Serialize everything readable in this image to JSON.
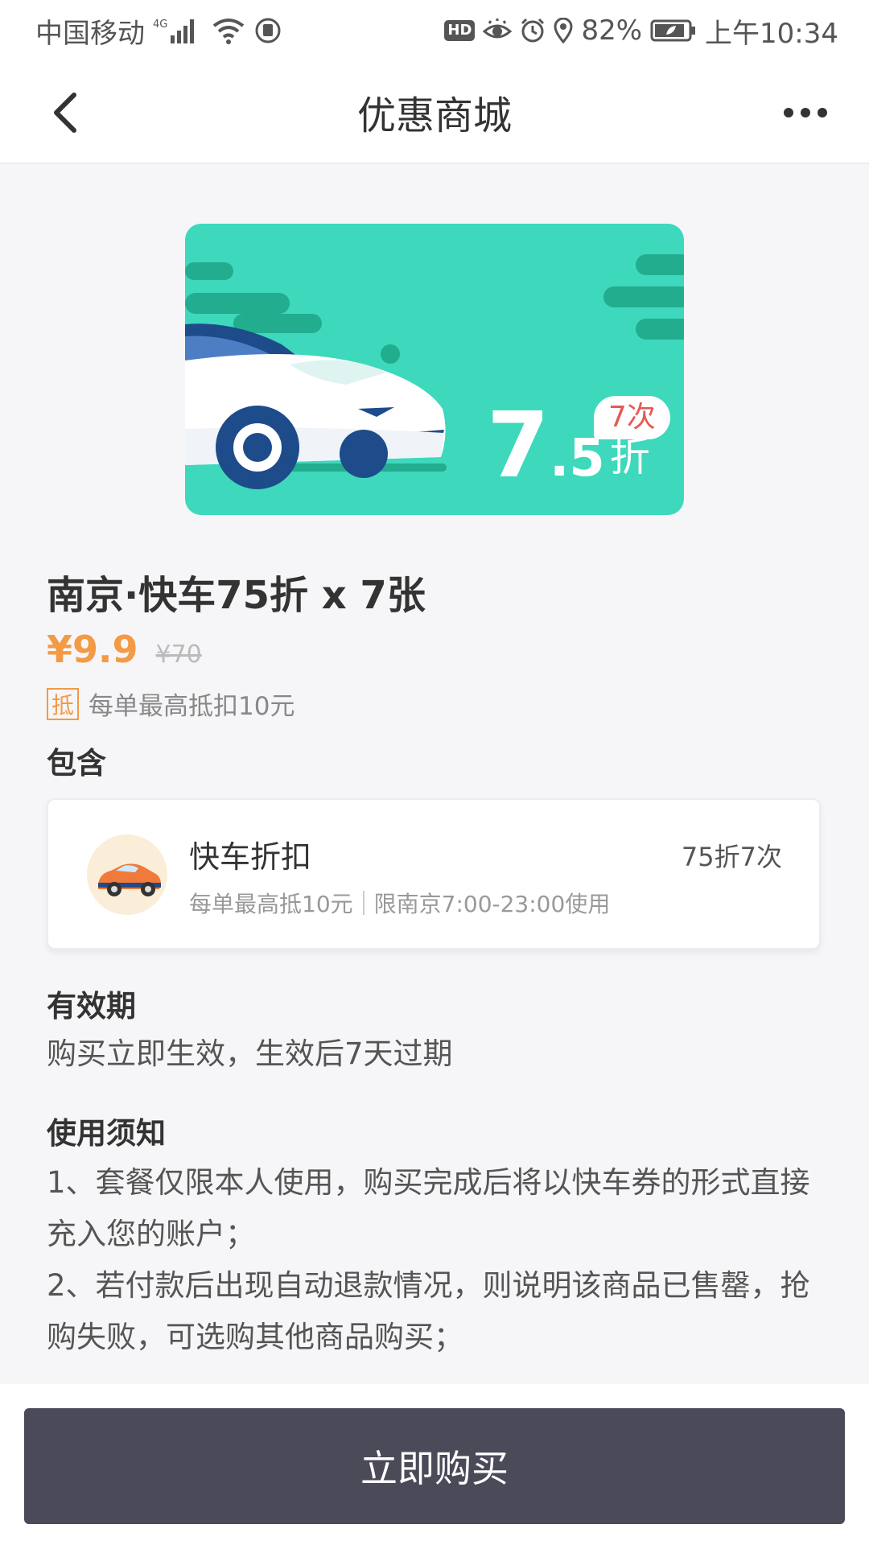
{
  "status_bar": {
    "carrier": "中国移动",
    "network": "4G",
    "battery": "82%",
    "time": "上午10:34",
    "hd_label": "HD",
    "icons": [
      "signal-icon",
      "wifi-icon",
      "app-notification-icon",
      "eye-icon",
      "alarm-icon",
      "location-icon",
      "battery-icon"
    ]
  },
  "navbar": {
    "title": "优惠商城",
    "back_icon": "chevron-left-icon",
    "more_icon": "more-dots-icon"
  },
  "banner": {
    "discount_main": "7",
    "discount_dot": ".5",
    "discount_unit": "折",
    "count_badge": "7次",
    "colors": {
      "background": "#3ed8bc",
      "dark_stripes": "#22ad8e",
      "car_blue": "#1e4b8a"
    }
  },
  "product": {
    "title": "南京·快车75折 x 7张",
    "price": "¥9.9",
    "original_price": "¥70",
    "deduct_tag": "抵",
    "deduct_text": "每单最高抵扣10元"
  },
  "includes": {
    "label": "包含",
    "item": {
      "title": "快车折扣",
      "limit": "每单最高抵10元",
      "scope": "限南京7:00-23:00使用",
      "count": "75折7次",
      "icon": "car-icon"
    }
  },
  "validity": {
    "label": "有效期",
    "text": "购买立即生效，生效后7天过期"
  },
  "notice": {
    "label": "使用须知",
    "items": [
      "1、套餐仅限本人使用，购买完成后将以快车券的形式直接充入您的账户；",
      "2、若付款后出现自动退款情况，则说明该商品已售罄，抢购失败，可选购其他商品购买；"
    ]
  },
  "footer": {
    "buy_label": "立即购买"
  },
  "colors": {
    "accent_orange": "#f39a45",
    "button_dark": "#4b4a59",
    "badge_red": "#e35b55"
  }
}
